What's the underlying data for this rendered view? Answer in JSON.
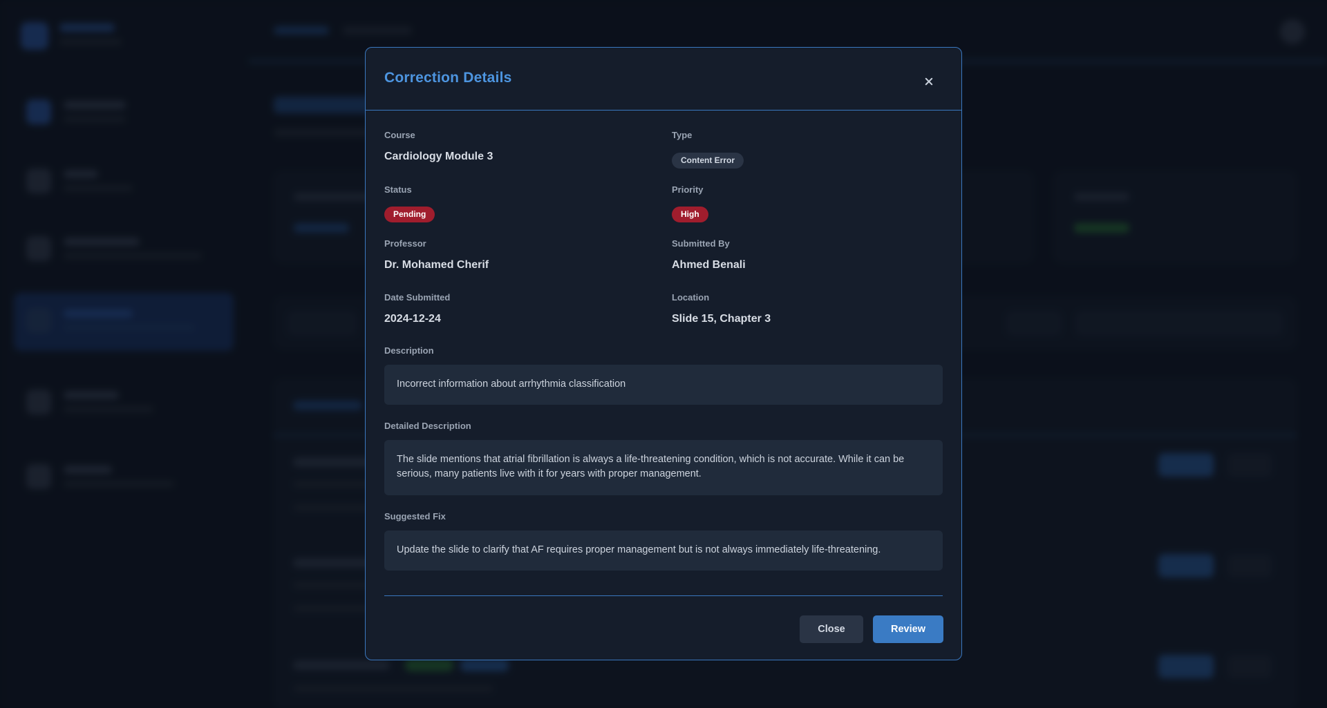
{
  "modal": {
    "title": "Correction Details",
    "fields": {
      "course": {
        "label": "Course",
        "value": "Cardiology Module 3"
      },
      "type": {
        "label": "Type",
        "value": "Content Error"
      },
      "status": {
        "label": "Status",
        "value": "Pending"
      },
      "priority": {
        "label": "Priority",
        "value": "High"
      },
      "professor": {
        "label": "Professor",
        "value": "Dr. Mohamed Cherif"
      },
      "submitted_by": {
        "label": "Submitted By",
        "value": "Ahmed Benali"
      },
      "date_submitted": {
        "label": "Date Submitted",
        "value": "2024-12-24"
      },
      "location": {
        "label": "Location",
        "value": "Slide 15, Chapter 3"
      }
    },
    "description": {
      "label": "Description",
      "text": "Incorrect information about arrhythmia classification"
    },
    "detailed_description": {
      "label": "Detailed Description",
      "text": "The slide mentions that atrial fibrillation is always a life-threatening condition, which is not accurate. While it can be serious, many patients live with it for years with proper management."
    },
    "suggested_fix": {
      "label": "Suggested Fix",
      "text": "Update the slide to clarify that AF requires proper management but is not always immediately life-threatening."
    },
    "buttons": {
      "close": "Close",
      "review": "Review"
    }
  },
  "colors": {
    "accent": "#3a7bc4",
    "title": "#4d95e0",
    "danger_badge": "#a01d2d",
    "modal_bg": "#151d2b",
    "border": "#3a78c0"
  },
  "icons": {
    "close": "close-icon"
  }
}
